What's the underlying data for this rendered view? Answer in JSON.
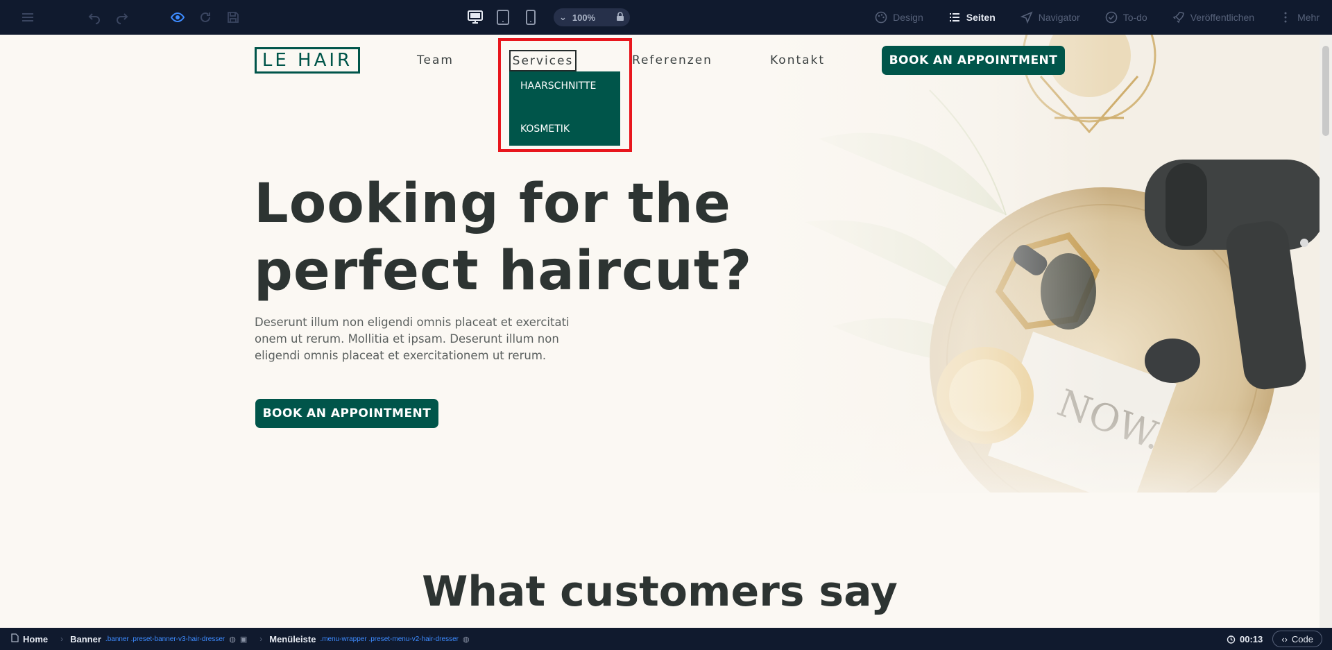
{
  "toolbar": {
    "zoom": "100%",
    "right_items": [
      {
        "label": "Design",
        "icon": "palette-icon"
      },
      {
        "label": "Seiten",
        "icon": "list-icon"
      },
      {
        "label": "Navigator",
        "icon": "navigation-icon"
      },
      {
        "label": "To-do",
        "icon": "check-circle-icon"
      },
      {
        "label": "Veröffentlichen",
        "icon": "rocket-icon"
      },
      {
        "label": "Mehr",
        "icon": "more-vertical-icon"
      }
    ]
  },
  "site": {
    "logo": "LE HAIR",
    "nav": {
      "team": "Team",
      "services": "Services",
      "referenzen": "Referenzen",
      "kontakt": "Kontakt"
    },
    "dropdown": {
      "item1": "HAARSCHNITTE",
      "item2": "KOSMETIK"
    },
    "header_cta": "BOOK AN APPOINTMENT",
    "hero": {
      "title_line1": "Looking for the",
      "title_line2": "perfect haircut?",
      "text": "Deserunt illum non eligendi omnis placeat et exercitati onem ut rerum. Mollitia et ipsam. Deserunt illum non eligendi omnis placeat et exercitationem ut rerum.",
      "cta": "BOOK AN APPOINTMENT"
    },
    "section_title": "What customers say"
  },
  "breadcrumb": {
    "home": "Home",
    "banner": "Banner",
    "banner_class": ".banner .preset-banner-v3-hair-dresser",
    "menu": "Menüleiste",
    "menu_class": ".menu-wrapper .preset-menu-v2-hair-dresser"
  },
  "status": {
    "timer": "00:13",
    "code": "Code"
  },
  "colors": {
    "brand": "#00554a",
    "highlight": "#e8161d",
    "toolbar_bg": "#101a2e",
    "accent_blue": "#3d8bff"
  }
}
